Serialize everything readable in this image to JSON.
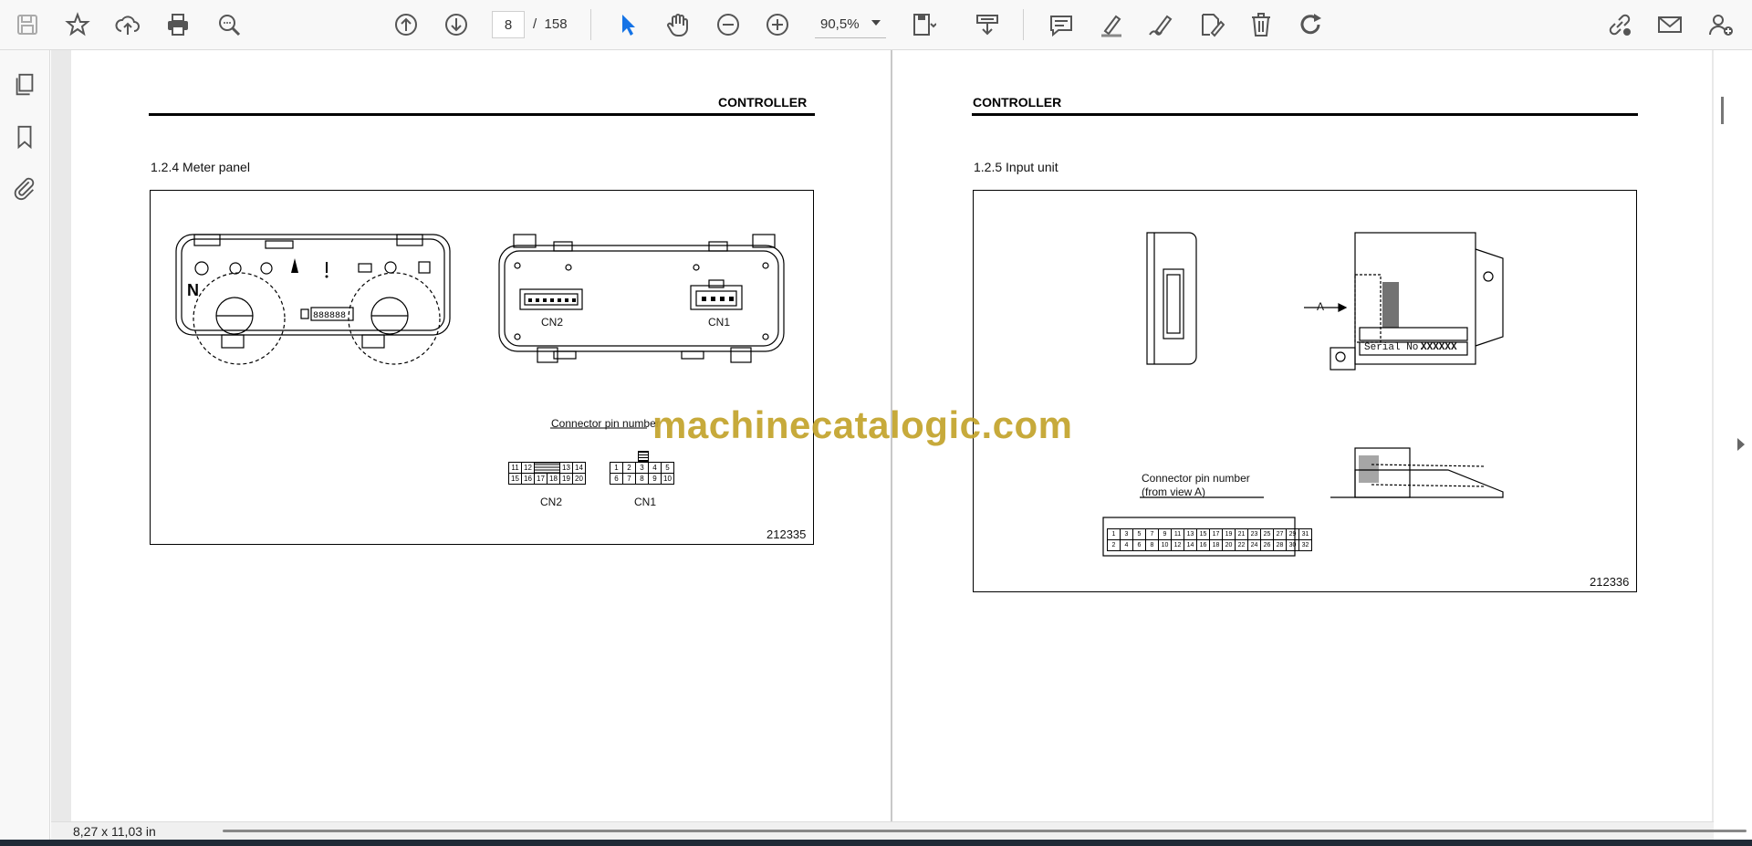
{
  "toolbar": {
    "current_page": "8",
    "page_separator": "/",
    "total_pages": "158",
    "zoom": "90,5%"
  },
  "status": {
    "page_size": "8,27 x 11,03 in"
  },
  "watermark": "machinecatalogic.com",
  "left_page": {
    "header": "CONTROLLER",
    "section": "1.2.4   Meter panel",
    "cn2_label": "CN2",
    "cn1_label": "CN1",
    "connector_title": "Connector pin number",
    "cn2_pins_top": [
      "11",
      "12",
      "",
      "13",
      "14"
    ],
    "cn2_pins_bottom": [
      "15",
      "16",
      "17",
      "18",
      "19",
      "20"
    ],
    "cn1_pins_top": [
      "1",
      "2",
      "3",
      "4",
      "5"
    ],
    "cn1_pins_bottom": [
      "6",
      "7",
      "8",
      "9",
      "10"
    ],
    "cn2_table_label": "CN2",
    "cn1_table_label": "CN1",
    "figure_number": "212335",
    "neutral_indicator": "N",
    "odometer": "888888"
  },
  "right_page": {
    "header": "CONTROLLER",
    "section": "1.2.5   Input unit",
    "view_label": "A",
    "serial_label": "Serial No.",
    "serial_value": "XXXXXX",
    "connector_title_line1": "Connector pin number",
    "connector_title_line2": "(from view  A)",
    "pins_top": [
      "1",
      "3",
      "5",
      "7",
      "9",
      "11",
      "13",
      "15",
      "17",
      "19",
      "21",
      "23",
      "25",
      "27",
      "29",
      "31"
    ],
    "pins_bottom": [
      "2",
      "4",
      "6",
      "8",
      "10",
      "12",
      "14",
      "16",
      "18",
      "20",
      "22",
      "24",
      "26",
      "28",
      "30",
      "32"
    ],
    "figure_number": "212336"
  },
  "colors": {
    "watermark": "#c3a32b",
    "select_tool": "#1473e6",
    "toolbar_bg": "#f8f8f8"
  },
  "icons": [
    "save-icon",
    "bookmark-star-icon",
    "upload-cloud-icon",
    "print-icon",
    "zoom-out-search-icon",
    "page-up-icon",
    "page-down-icon",
    "select-cursor-icon",
    "hand-icon",
    "zoom-minus-icon",
    "zoom-plus-icon",
    "page-fit-icon",
    "scroll-mode-icon",
    "comment-icon",
    "highlight-pen-icon",
    "draw-icon",
    "edit-sign-icon",
    "delete-icon",
    "redo-icon",
    "share-link-icon",
    "mail-icon",
    "add-user-icon",
    "pages-icon",
    "bookmark-icon",
    "attachment-icon"
  ]
}
